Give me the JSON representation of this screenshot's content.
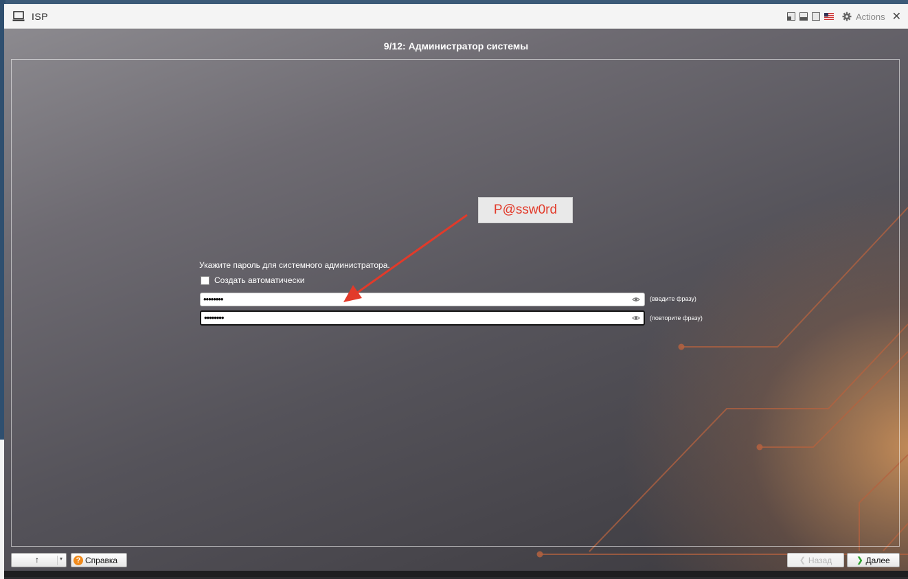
{
  "window": {
    "title": "ISP",
    "actions_label": "Actions",
    "icons": [
      "monitor-icon",
      "window-dock-icon",
      "window-half-icon",
      "window-full-icon",
      "us-flag-icon",
      "gear-icon",
      "close-icon"
    ]
  },
  "installer": {
    "step_title": "9/12: Администратор системы",
    "prompt": "Укажите пароль для системного администратора.",
    "auto_checkbox": {
      "label": "Создать автоматически",
      "checked": false
    },
    "password_field": {
      "value": "••••••••",
      "hint": "(введите фразу)"
    },
    "confirm_field": {
      "value": "••••••••",
      "hint": "(повторите фразу)"
    }
  },
  "annotation": {
    "text": "P@ssw0rd",
    "color": "#e23a2a"
  },
  "footer": {
    "nav_up_symbol": "↑",
    "nav_dropdown_symbol": "▾",
    "help_label": "Справка",
    "help_icon_glyph": "?",
    "back_label": "Назад",
    "back_chevron": "❮",
    "next_label": "Далее",
    "next_chevron": "❯"
  },
  "colors": {
    "help_icon": "#f08a1c",
    "next_chevron": "#2ea12e",
    "accent_lines": "#b5623f"
  }
}
